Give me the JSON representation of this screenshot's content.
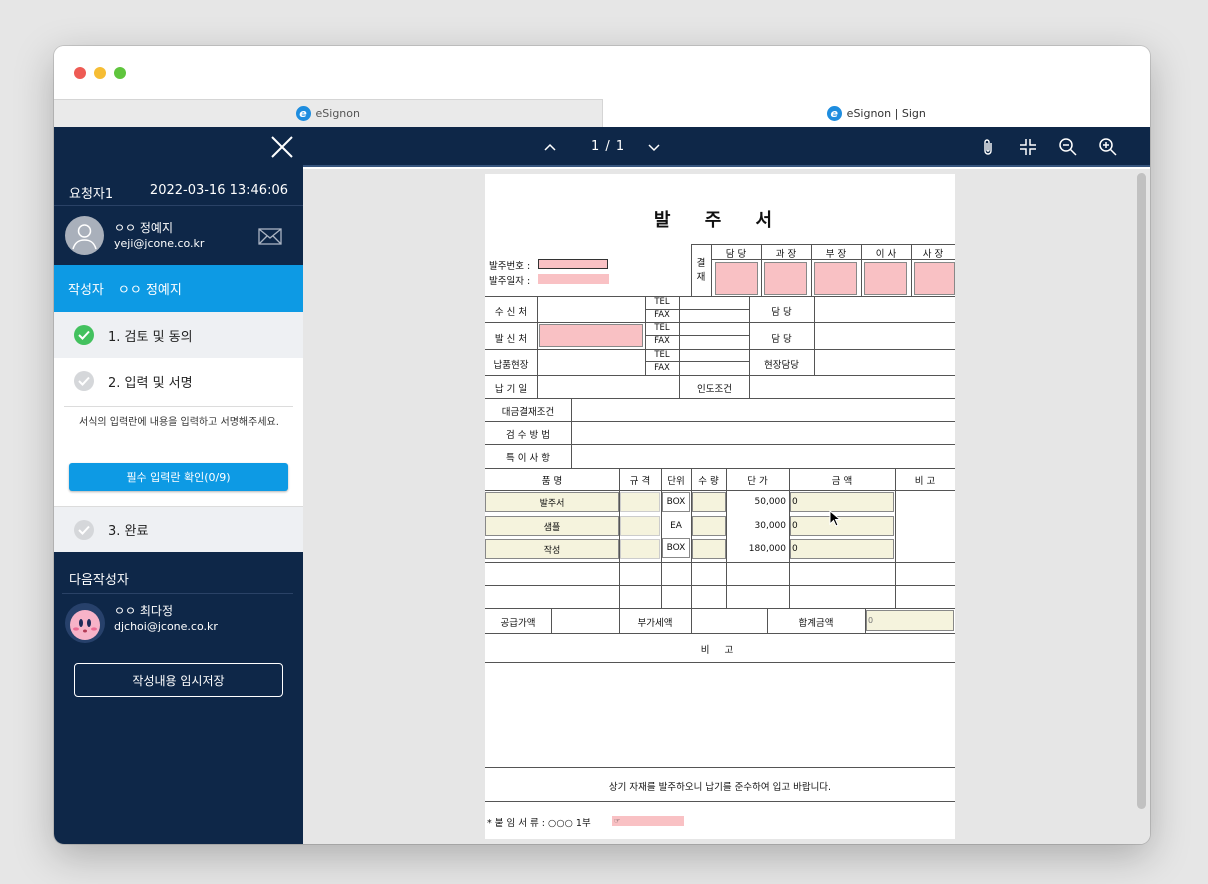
{
  "tabs": [
    {
      "label": "eSignon",
      "active": false
    },
    {
      "label": "eSignon | Sign",
      "active": true
    }
  ],
  "sidebar": {
    "requester_label": "요청자1",
    "request_datetime": "2022-03-16 13:46:06",
    "requester": {
      "name": "ㅇㅇ 정예지",
      "email": "yeji@jcone.co.kr"
    },
    "writer_label": "작성자",
    "writer_name": "ㅇㅇ 정예지",
    "steps": [
      {
        "label": "1. 검토 및 동의",
        "status": "done"
      },
      {
        "label": "2. 입력 및 서명",
        "status": "current"
      },
      {
        "label": "3. 완료",
        "status": "pending"
      }
    ],
    "step2_description": "서식의 입력란에 내용을 입력하고 서명해주세요.",
    "required_check_button": "필수 입력란 확인(0/9)",
    "next_writer_label": "다음작성자",
    "next_writer": {
      "name": "ㅇㅇ 최다정",
      "email": "djchoi@jcone.co.kr"
    },
    "temp_save_button": "작성내용 임시저장"
  },
  "toolbar": {
    "page_info": "1 / 1",
    "icons": [
      "chevron-up-icon",
      "chevron-down-icon",
      "paperclip-icon",
      "fit-page-icon",
      "zoom-out-icon",
      "zoom-in-icon"
    ]
  },
  "document": {
    "title": "발 주 서",
    "order_no_label": "발주번호 :",
    "order_date_label": "발주일자 :",
    "approval_label": "결 재",
    "approval_columns": [
      "담 당",
      "과 장",
      "부 장",
      "이 사",
      "사 장"
    ],
    "recipient_label": "수 신 처",
    "sender_label": "발 신 처",
    "delivery_site_label": "납품현장",
    "due_date_label": "납 기 일",
    "tel_label": "TEL",
    "fax_label": "FAX",
    "manager_label": "담 당",
    "site_manager_label": "현장담당",
    "handover_label": "인도조건",
    "payment_label": "대금결재조건",
    "inspection_label": "검 수 방 법",
    "special_label": "특 이 사 항",
    "item_headers": [
      "품 명",
      "규 격",
      "단위",
      "수 량",
      "단 가",
      "금 액",
      "비 고"
    ],
    "items": [
      {
        "name": "발주서",
        "unit": "BOX",
        "price": "50,000",
        "amount": "0"
      },
      {
        "name": "샘플",
        "unit": "EA",
        "price": "30,000",
        "amount": "0"
      },
      {
        "name": "작성",
        "unit": "BOX",
        "price": "180,000",
        "amount": "0"
      }
    ],
    "supply_label": "공급가액",
    "vat_label": "부가세액",
    "total_label": "합계금액",
    "total_value": "0",
    "remarks_label": "비 고",
    "footer_text": "상기 자재를 발주하오니 납기를 준수하여 입고 바랍니다.",
    "attachment_label": "* 붙 임 서 류 : ○○○ 1부",
    "attachment_mark": "☞"
  },
  "colors": {
    "sidebar_bg": "#0e2748",
    "accent": "#0d9ae4",
    "input_pink": "#f9c1c4",
    "input_yellow": "#f5f3dd"
  }
}
